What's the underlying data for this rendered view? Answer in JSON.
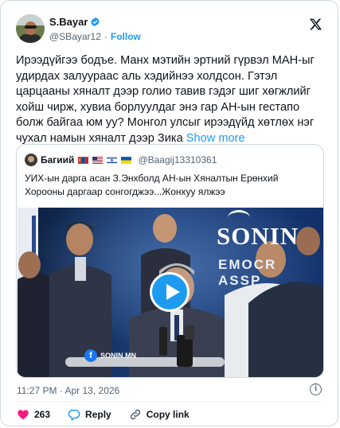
{
  "author": {
    "name": "S.Bayar",
    "handle": "@SBayar12",
    "separator": "·",
    "follow_label": "Follow",
    "verified_color": "#1d9bf0"
  },
  "tweet": {
    "text": "Ирээдүйгээ бодъе. Манх мэтийн эртний гүрвэл МАН-ыг удирдах залуураас аль хэдийнээ холдсон. Гэтэл царцааны хяналт дээр голио тавив гэдэг шиг хөгжлийг хойш чирж, хувиа борлуулдаг энэ гар АН-ын гестапо болж байгаа юм уу? Монгол улсыг ирээдүйд хөтлөх нэг чухал намын хяналт дээр Зика",
    "show_more": "Show more"
  },
  "quote": {
    "name": "Багиий",
    "flags": [
      "mongolia",
      "usa",
      "israel",
      "ukraine"
    ],
    "handle": "@Baagij13310361",
    "text": "УИХ-ын дарга асан З.Энхболд АН-ын Хяналтын Ерөнхий Хорооны даргаар сонгогджээ...Жонхуу ялжээ",
    "media": {
      "type": "video",
      "backdrop_logo": "SONIN",
      "backdrop_text": "EMOCR ASSP",
      "watermark": "SONIN.MN"
    }
  },
  "meta": {
    "time": "11:27 PM",
    "separator": "·",
    "date": "Apr 13, 2026"
  },
  "actions": {
    "likes": "263",
    "reply_label": "Reply",
    "copy_label": "Copy link",
    "like_color": "#f91880"
  },
  "icons": [
    "verified-badge-icon",
    "x-logo-icon",
    "play-icon",
    "info-icon",
    "heart-icon",
    "reply-icon",
    "link-icon",
    "facebook-icon"
  ]
}
